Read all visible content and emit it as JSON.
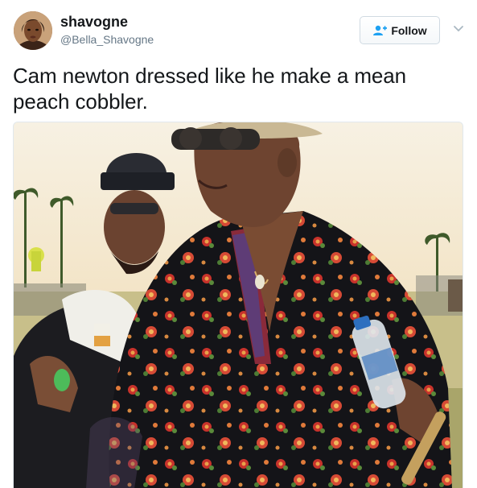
{
  "user": {
    "display_name": "shavogne",
    "handle": "@Bella_Shavogne",
    "avatar_icon": "profile-photo"
  },
  "actions": {
    "follow_label": "Follow",
    "follow_icon": "add-user-icon",
    "menu_icon": "chevron-down-icon"
  },
  "tweet": {
    "text": "Cam newton dressed like he make a mean peach cobbler."
  },
  "media": {
    "type": "photo",
    "alt_icon": "tweet-photo"
  },
  "colors": {
    "text_primary": "#14171a",
    "text_secondary": "#657786",
    "accent_blue": "#1da1f2",
    "border": "#e1e8ed"
  }
}
